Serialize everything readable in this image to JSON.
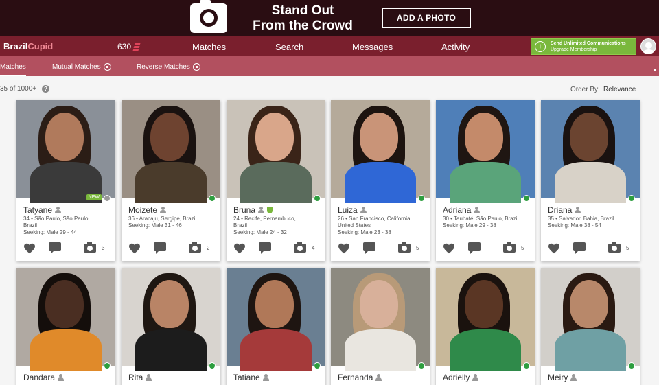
{
  "promo": {
    "headline_line1": "Stand Out",
    "headline_line2": "From the Crowd",
    "button_label": "ADD A PHOTO"
  },
  "nav": {
    "logo_part1": "Brazil",
    "logo_part2": "Cupid",
    "match_count": "630",
    "items": [
      "Matches",
      "Search",
      "Messages",
      "Activity"
    ],
    "upgrade_line1": "Send Unlimited Communications",
    "upgrade_line2": "Upgrade Membership"
  },
  "subnav": {
    "tabs": [
      "Matches",
      "Mutual Matches",
      "Reverse Matches"
    ]
  },
  "results": {
    "count_text": "35 of 1000+",
    "order_by_label": "Order By:",
    "order_by_value": "Relevance"
  },
  "profiles": [
    {
      "name": "Tatyane",
      "line1": "34 • São Paulo, São Paulo,",
      "line2": "Brazil",
      "seeking": "Seeking: Male 29 - 44",
      "photos": "3",
      "new_badge": "NEW",
      "online": false,
      "skin": "#b07a5c",
      "hair": "#2b1d16",
      "bg": "#8a9098",
      "top": "#3a3a3a"
    },
    {
      "name": "Moizete",
      "line1": "36 • Aracaju, Sergipe, Brazil",
      "line2": "",
      "seeking": "Seeking: Male 31 - 46",
      "photos": "2",
      "online": true,
      "skin": "#6e4330",
      "hair": "#1a1210",
      "bg": "#9a8f84",
      "top": "#4a3b2b"
    },
    {
      "name": "Bruna",
      "line1": "24 • Recife, Pernambuco,",
      "line2": "Brazil",
      "seeking": "Seeking: Male 24 - 32",
      "photos": "4",
      "verified": true,
      "online": true,
      "skin": "#d9a68a",
      "hair": "#3a2418",
      "bg": "#c9c2b8",
      "top": "#5a6b5c"
    },
    {
      "name": "Luiza",
      "line1": "26 • San Francisco, California,",
      "line2": "United States",
      "seeking": "Seeking: Male 23 - 38",
      "photos": "5",
      "online": true,
      "skin": "#c99478",
      "hair": "#1d1410",
      "bg": "#b5aa9a",
      "top": "#2f67d6"
    },
    {
      "name": "Adriana",
      "line1": "30 • Taubaté, São Paulo, Brazil",
      "line2": "",
      "seeking": "Seeking: Male 29 - 38",
      "photos": "5",
      "online": true,
      "skin": "#c48a6a",
      "hair": "#1f1612",
      "bg": "#4f7fb8",
      "top": "#5aa47a"
    },
    {
      "name": "Driana",
      "line1": "35 • Salvador, Bahia, Brazil",
      "line2": "",
      "seeking": "Seeking: Male 38 - 54",
      "photos": "5",
      "online": true,
      "skin": "#6b4430",
      "hair": "#1a1210",
      "bg": "#5b83b0",
      "top": "#d8d2c8"
    },
    {
      "name": "Dandara",
      "line1": "",
      "line2": "",
      "seeking": "",
      "photos": "",
      "online": true,
      "skin": "#4a2e22",
      "hair": "#140e0b",
      "bg": "#b0a9a2",
      "top": "#e08a2a"
    },
    {
      "name": "Rita",
      "line1": "",
      "line2": "",
      "seeking": "",
      "photos": "",
      "online": true,
      "skin": "#b98466",
      "hair": "#1f1712",
      "bg": "#d8d4cf",
      "top": "#1c1c1c"
    },
    {
      "name": "Tatiane",
      "line1": "",
      "line2": "",
      "seeking": "",
      "photos": "",
      "online": true,
      "skin": "#b07858",
      "hair": "#1e1511",
      "bg": "#6a7f92",
      "top": "#a53a3a"
    },
    {
      "name": "Fernanda",
      "line1": "",
      "line2": "",
      "seeking": "",
      "photos": "",
      "online": true,
      "skin": "#d8b09a",
      "hair": "#b89a78",
      "bg": "#8d8a80",
      "top": "#e9e6e0"
    },
    {
      "name": "Adrielly",
      "line1": "",
      "line2": "",
      "seeking": "",
      "photos": "",
      "online": true,
      "skin": "#5a3624",
      "hair": "#1a120e",
      "bg": "#c8b89a",
      "top": "#2f8a4a"
    },
    {
      "name": "Meiry",
      "line1": "",
      "line2": "",
      "seeking": "",
      "photos": "",
      "online": true,
      "skin": "#b8886a",
      "hair": "#2a1a12",
      "bg": "#d2cfca",
      "top": "#6fa0a4"
    }
  ]
}
